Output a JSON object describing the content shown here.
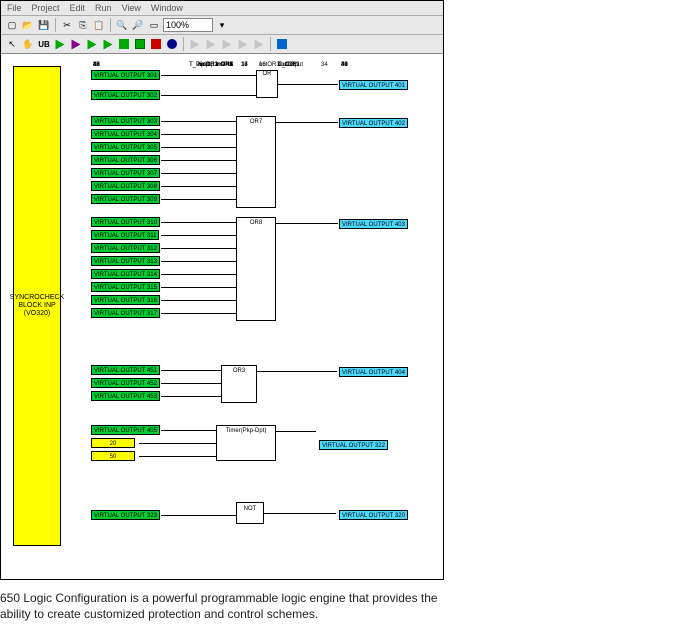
{
  "menu": {
    "file": "File",
    "project": "Project",
    "edit": "Edit",
    "run": "Run",
    "view": "View",
    "window": "Window"
  },
  "toolbar": {
    "zoom": "100%"
  },
  "block": {
    "label": "SYNCROCHECK\nBLOCK INP\n(VO320)"
  },
  "nums": {
    "n17": "17",
    "n18": "18",
    "n19": "19",
    "n25": "25",
    "n42": "42",
    "n16": "16",
    "n15": "15",
    "n14": "14",
    "n42b": "42",
    "n47": "47",
    "n37": "37",
    "n39": "39",
    "n40": "40",
    "n41": "41",
    "n48": "48",
    "n34": "34",
    "n43": "43",
    "n36": "36",
    "n38": "38"
  },
  "gates": {
    "or16": "OR",
    "or7": "OR7",
    "or8": "OR8",
    "or3": "OR3",
    "timer": "Timer(Pkp-Dpt)",
    "not": "NOT"
  },
  "pins": {
    "inOR1": "inOR1",
    "inOR2": "inOR2",
    "inOR3": "inOR3",
    "inOR4": "inOR4",
    "inOR5": "inOR5",
    "inOR6": "inOR6",
    "inOR7": "inOR7",
    "inOR8": "inOR8",
    "outOR1": "OutOR1",
    "outOR1b": "outOR1",
    "t_input": "T_Input",
    "t_pickup": "T_Pickup",
    "t_dropt": "T_Dropt",
    "t_output": "T_Output"
  },
  "vo": {
    "o301": "VIRTUAL OUTPUT 301",
    "o302": "VIRTUAL OUTPUT 302",
    "o303": "VIRTUAL OUTPUT 303",
    "o304": "VIRTUAL OUTPUT 304",
    "o305": "VIRTUAL OUTPUT 305",
    "o306": "VIRTUAL OUTPUT 306",
    "o307": "VIRTUAL OUTPUT 307",
    "o308": "VIRTUAL OUTPUT 308",
    "o309": "VIRTUAL OUTPUT 309",
    "o310": "VIRTUAL OUTPUT 310",
    "o311": "VIRTUAL OUTPUT 311",
    "o312": "VIRTUAL OUTPUT 312",
    "o313": "VIRTUAL OUTPUT 313",
    "o314": "VIRTUAL OUTPUT 314",
    "o315": "VIRTUAL OUTPUT 315",
    "o316": "VIRTUAL OUTPUT 316",
    "o317": "VIRTUAL OUTPUT 317",
    "o401": "VIRTUAL OUTPUT 401",
    "o402": "VIRTUAL OUTPUT 402",
    "o403": "VIRTUAL OUTPUT 403",
    "o404": "VIRTUAL OUTPUT 404",
    "o451": "VIRTUAL OUTPUT 451",
    "o452": "VIRTUAL OUTPUT 452",
    "o453": "VIRTUAL OUTPUT 453",
    "o405": "VIRTUAL OUTPUT 405",
    "o322": "VIRTUAL OUTPUT 322",
    "o323": "VIRTUAL OUTPUT 323",
    "o320": "VIRTUAL OUTPUT 320",
    "k20": "20",
    "k50": "50"
  },
  "caption": "650 Logic Configuration is a powerful programmable logic engine that provides the ability to create customized protection and control schemes."
}
